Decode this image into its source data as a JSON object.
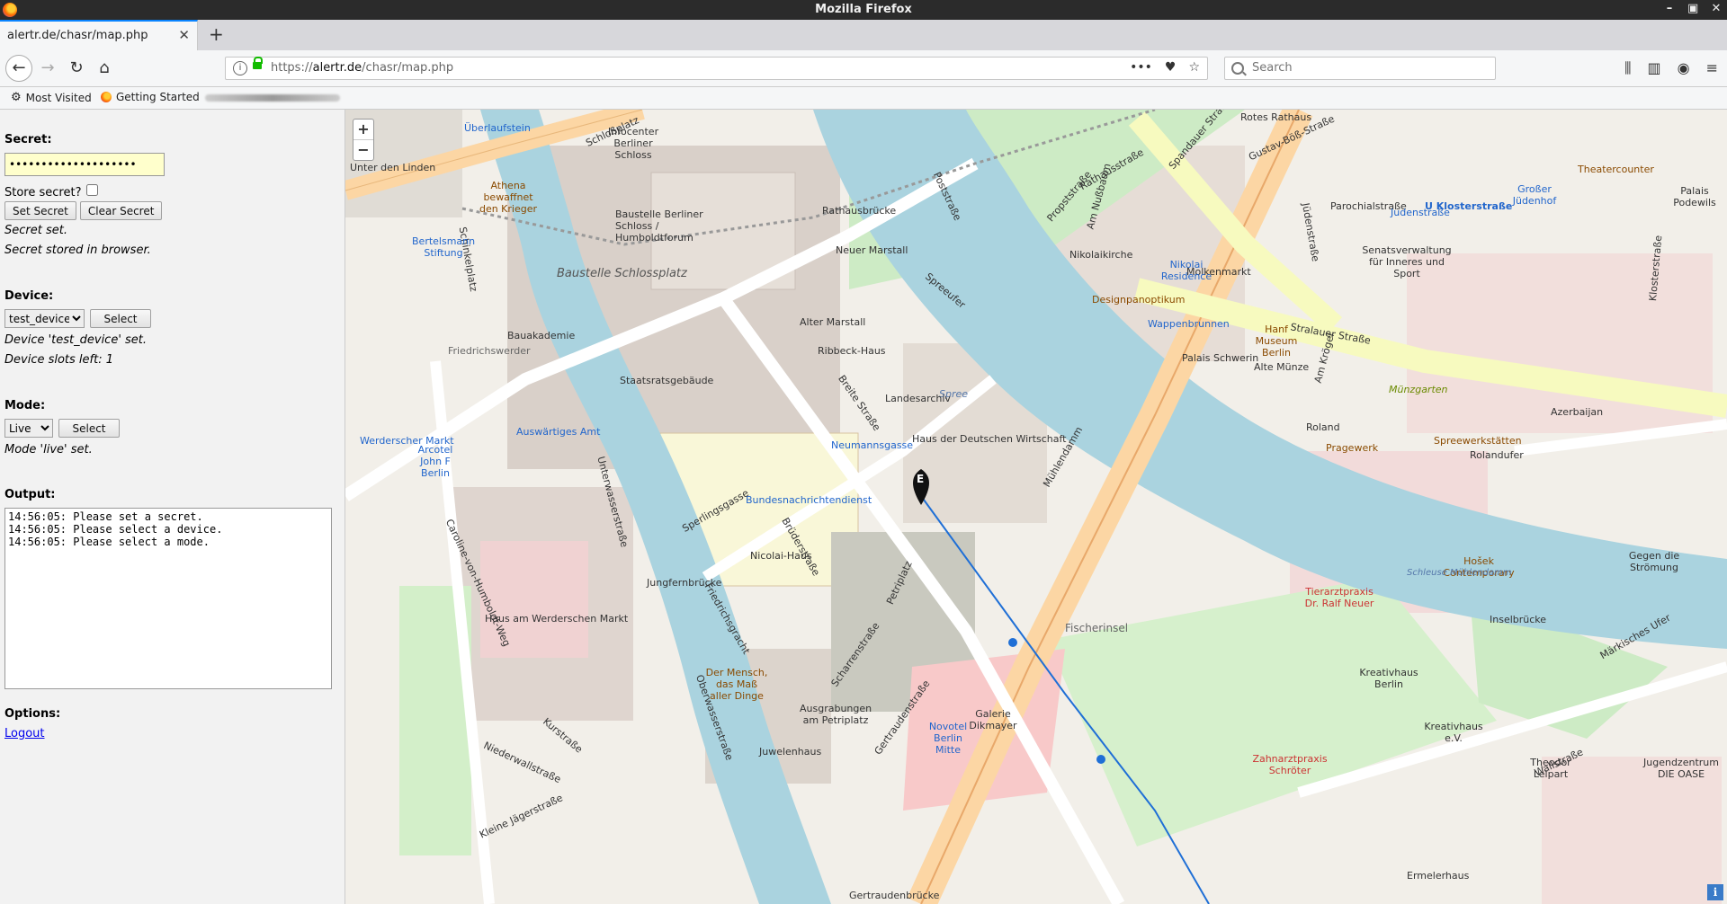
{
  "window": {
    "title": "Mozilla Firefox"
  },
  "tab": {
    "title": "alertr.de/chasr/map.php"
  },
  "url": {
    "prefix": "https://",
    "host": "alertr.de",
    "path": "/chasr/map.php"
  },
  "search": {
    "placeholder": "Search"
  },
  "bookmarks": {
    "most_visited": "Most Visited",
    "getting_started": "Getting Started"
  },
  "panel": {
    "secret_heading": "Secret:",
    "secret_value": "••••••••••••••••••••",
    "store_secret_label": "Store secret?",
    "set_secret_button": "Set Secret",
    "clear_secret_button": "Clear Secret",
    "secret_msg_1": "Secret set.",
    "secret_msg_2": "Secret stored in browser.",
    "device_heading": "Device:",
    "device_selected": "test_device",
    "device_select_button": "Select",
    "device_msg_1": "Device 'test_device' set.",
    "device_msg_2": "Device slots left: 1",
    "mode_heading": "Mode:",
    "mode_selected": "Live",
    "mode_select_button": "Select",
    "mode_msg": "Mode 'live' set.",
    "output_heading": "Output:",
    "output_text": "14:56:05: Please set a secret.\n14:56:05: Please select a device.\n14:56:05: Please select a mode.",
    "options_heading": "Options:",
    "logout_link": "Logout"
  },
  "map": {
    "zoom_in": "+",
    "zoom_out": "−",
    "attribution_icon": "i",
    "marker_letter": "E",
    "labels": [
      "Unter den Linden",
      "Schloßplatz",
      "Baustelle Schlossplatz",
      "Baustelle Berliner Schloss / Humboldtforum",
      "Rathausbrücke",
      "Spreeufer",
      "Spree",
      "Neuer Marstall",
      "Alter Marstall",
      "Ribbeck-Haus",
      "Staatsratsgebäude",
      "Breite Straße",
      "Landesarchiv",
      "Haus der Deutschen Wirtschaft",
      "Neumannsgasse",
      "Bundesnachrichtendienst",
      "Sperlingsgasse",
      "Jungfernbrücke",
      "Friedrichsgracht",
      "Nicolai-Haus",
      "Brüderstraße",
      "Fischerinsel",
      "Mühlendamm",
      "Molkenmarkt",
      "Stralauer Straße",
      "Nikolaikirche",
      "Poststraße",
      "Propststraße",
      "Spandauer Straße",
      "Gustav-Böß-Straße",
      "Jüdenstraße",
      "Parochialstraße",
      "U Klosterstraße",
      "Senatsverwaltung für Inneres und Sport",
      "Palais Schwerin",
      "Alte Münze",
      "Am Krögel",
      "Roland",
      "Rolandufer",
      "Inselbrücke",
      "Märkisches Ufer",
      "Wallstraße",
      "Gertraudenstraße",
      "Gertraudenbrücke",
      "Unterwasserstraße",
      "Oberwasserstraße",
      "Kurstraße",
      "Niederwallstraße",
      "Werderscher Markt",
      "Auswärtiges Amt",
      "Haus am Werderschen Markt",
      "Bauakademie",
      "Friedrichswerder",
      "Schinkelplatz",
      "Caroline-von-Humboldt-Weg",
      "Kleine Jägerstraße",
      "Petriplatz",
      "Scharrenstraße",
      "Ausgrabungen am Petriplatz",
      "Juwelenhaus",
      "Galerie Dikmayer",
      "Novotel Berlin Mitte",
      "Tierarztpraxis Dr. Ralf Neuer",
      "Kreativhaus Berlin",
      "Kreativhaus e.V.",
      "Zahnarztpraxis Schröter",
      "Theodor Leipart",
      "Jugendzentrum DIE OASE",
      "Ermelerhaus",
      "Hošek Contemporary",
      "Gegen die Strömung",
      "Spreewerkstätten",
      "Pragewerk",
      "Azerbaijan",
      "Münzgarten",
      "Hanf Museum Berlin",
      "Designpanoptikum",
      "Nikolai Residence",
      "Wappenbrunnen",
      "Theatercounter",
      "Großer Jüdenhof",
      "Judenstraße",
      "Infocenter Berliner Schloss",
      "Überlaufstein",
      "Athena bewaffnet den Krieger",
      "Bertelsmann Stiftung",
      "Rathausstraße",
      "Am Nußbaum",
      "Der Mensch, das Maß aller Dinge",
      "Arcotel John F Berlin",
      "Schleuse Mühlendamm",
      "Klosterstraße",
      "Rotes Rathaus",
      "Palais Podewils"
    ]
  }
}
